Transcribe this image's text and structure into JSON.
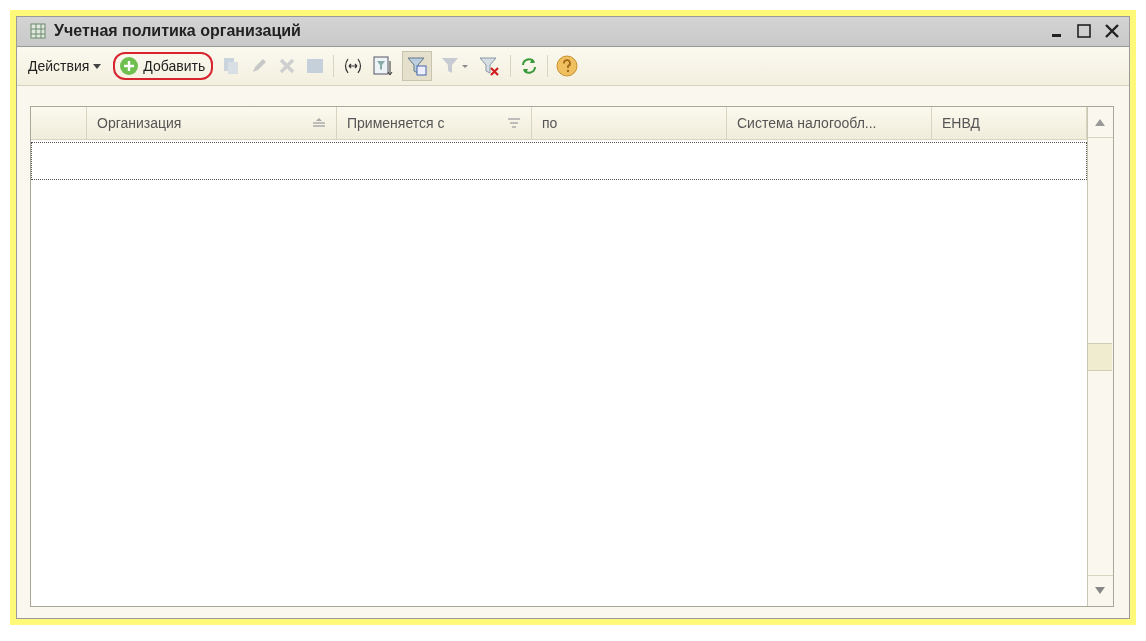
{
  "window": {
    "title": "Учетная политика организаций"
  },
  "toolbar": {
    "actions_menu": "Действия",
    "add_button": {
      "label": "Добавить",
      "highlighted": true
    }
  },
  "table": {
    "columns": [
      {
        "label": "Организация",
        "sorted": true,
        "filtered": false
      },
      {
        "label": "Применяется с",
        "sorted": false,
        "filtered": true
      },
      {
        "label": "по",
        "sorted": false,
        "filtered": false
      },
      {
        "label": "Система налогообл...",
        "sorted": false,
        "filtered": false
      },
      {
        "label": "ЕНВД",
        "sorted": false,
        "filtered": false
      }
    ],
    "focused_empty_row": true
  }
}
